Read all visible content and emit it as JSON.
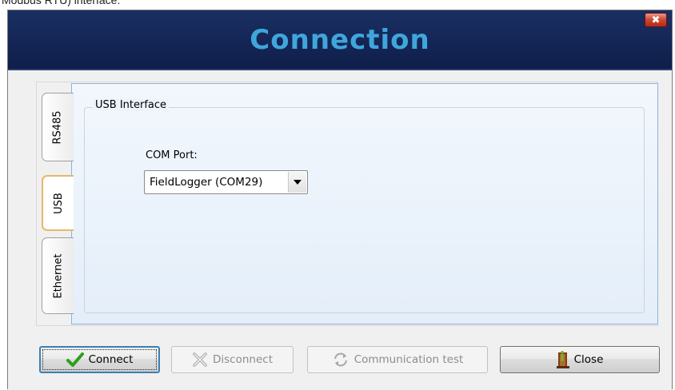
{
  "top_caption": "Modbus RTU) interface.",
  "window": {
    "title": "Connection",
    "close_glyph": "✖",
    "colors": {
      "titlebar": "#142656",
      "title_text": "#3fa6dc",
      "close": "#c0392b"
    }
  },
  "tabs": [
    {
      "label": "RS485",
      "active": false
    },
    {
      "label": "USB",
      "active": true
    },
    {
      "label": "Ethernet",
      "active": false
    }
  ],
  "usb_group": {
    "legend": "USB Interface",
    "com_port_label": "COM Port:",
    "com_port_value": "FieldLogger (COM29)"
  },
  "buttons": {
    "connect": {
      "label": "Connect",
      "icon": "check-icon",
      "enabled": true
    },
    "disconnect": {
      "label": "Disconnect",
      "icon": "disconnect-icon",
      "enabled": false
    },
    "communication_test": {
      "label": "Communication test",
      "icon": "refresh-icon",
      "enabled": false
    },
    "close": {
      "label": "Close",
      "icon": "door-exit-icon",
      "enabled": true
    }
  }
}
